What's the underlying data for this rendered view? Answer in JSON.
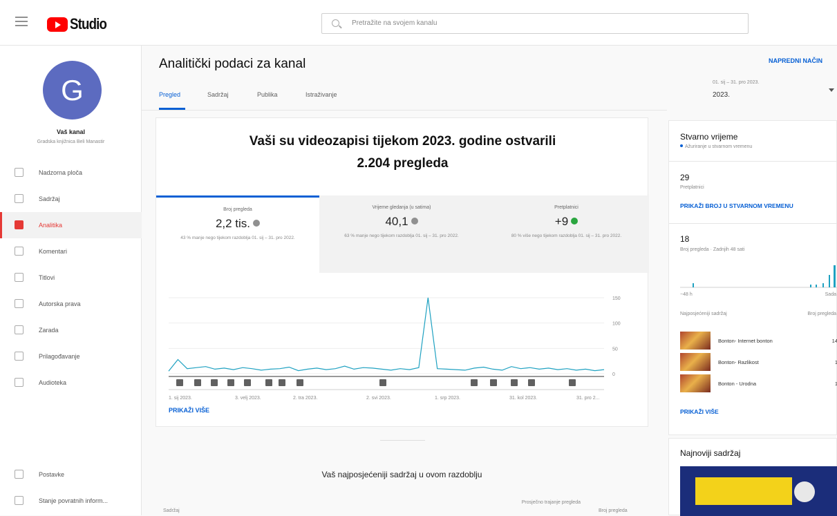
{
  "app": {
    "logo_text": "Studio"
  },
  "search": {
    "placeholder": "Pretražite na svojem kanalu"
  },
  "channel": {
    "initial": "G",
    "name": "Vaš kanal",
    "sub": "Gradska knjižnica Beli Manastir"
  },
  "sidebar": {
    "items": [
      {
        "label": "Nadzorna ploča",
        "icon": "dashboard-icon"
      },
      {
        "label": "Sadržaj",
        "icon": "content-icon"
      },
      {
        "label": "Analitika",
        "icon": "analytics-icon",
        "active": true
      },
      {
        "label": "Komentari",
        "icon": "comments-icon"
      },
      {
        "label": "Titlovi",
        "icon": "subtitles-icon"
      },
      {
        "label": "Autorska prava",
        "icon": "copyright-icon"
      },
      {
        "label": "Zarada",
        "icon": "monetization-icon"
      },
      {
        "label": "Prilagođavanje",
        "icon": "customization-icon"
      },
      {
        "label": "Audioteka",
        "icon": "audio-library-icon"
      }
    ],
    "bottom": [
      {
        "label": "Postavke",
        "icon": "settings-icon"
      },
      {
        "label": "Stanje povratnih inform...",
        "icon": "feedback-icon"
      }
    ]
  },
  "main": {
    "title": "Analitički podaci za kanal",
    "advanced_link": "NAPREDNI NAČIN",
    "date_range_label": "01. sij – 31. pro 2023.",
    "date_value": "2023.",
    "tabs": [
      "Pregled",
      "Sadržaj",
      "Publika",
      "Istraživanje"
    ],
    "headline_1": "Vaši su videozapisi tijekom 2023. godine ostvarili",
    "headline_2": "2.204 pregleda",
    "metrics": [
      {
        "label": "Broj pregleda",
        "value": "2,2 tis.",
        "compare": "43 % manje nego tijekom razdoblja 01. sij – 31. pro 2022."
      },
      {
        "label": "Vrijeme gledanja (u satima)",
        "value": "40,1",
        "compare": "63 % manje nego tijekom razdoblja 01. sij – 31. pro 2022."
      },
      {
        "label": "Pretplatnici",
        "value": "+9",
        "compare": "80 % više nego tijekom razdoblja 01. sij – 31. pro 2022."
      }
    ],
    "more_link": "PRIKAŽI VIŠE",
    "top_content_title": "Vaš najposjećeniji sadržaj u ovom razdoblju",
    "table_headers": {
      "content": "Sadržaj",
      "avg_duration": "Prosječno trajanje pregleda",
      "views": "Broj pregleda"
    }
  },
  "chart_data": {
    "type": "line",
    "x_ticks": [
      "1. sij 2023.",
      "3. velj 2023.",
      "2. tra 2023.",
      "2. svi 2023.",
      "1. srp 2023.",
      "31. kol 2023.",
      "31. pro 2..."
    ],
    "y_ticks": [
      "150",
      "100",
      "50",
      "0"
    ],
    "ylim": [
      0,
      150
    ],
    "spike_value": 150,
    "baseline_values": [
      5,
      28,
      10,
      12,
      14,
      9,
      11,
      8,
      12,
      10,
      7,
      9,
      10,
      13,
      6,
      9,
      11,
      8,
      10,
      15,
      9,
      12,
      11,
      9,
      7,
      10,
      8,
      12,
      150,
      10,
      9,
      8,
      7,
      11,
      13,
      9,
      7,
      14,
      10,
      12,
      9,
      11,
      8,
      10,
      7,
      9,
      6,
      8
    ],
    "series_color": "#1ea1c1"
  },
  "realtime": {
    "title": "Stvarno vrijeme",
    "sub": "Ažuriranje u stvarnom vremenu",
    "subscribers": "29",
    "subscribers_label": "Pretplatnici",
    "realtime_link": "PRIKAŽI BROJ U STVARNOM VREMENU",
    "views": "18",
    "views_label": "Broj pregleda · Zadnjih 48 sati",
    "axis_left": "−48 h",
    "axis_right": "Sada",
    "top_content_label": "Najposjećeniji sadržaj",
    "top_views_label": "Broj pregleda",
    "videos": [
      {
        "title": "Bonton- Internet bonton",
        "views": "14"
      },
      {
        "title": "Bonton- Razlikost",
        "views": "1"
      },
      {
        "title": "Bonton - Urodna",
        "views": "1"
      }
    ],
    "more_link": "PRIKAŽI VIŠE"
  },
  "latest": {
    "title": "Najnoviji sadržaj"
  }
}
